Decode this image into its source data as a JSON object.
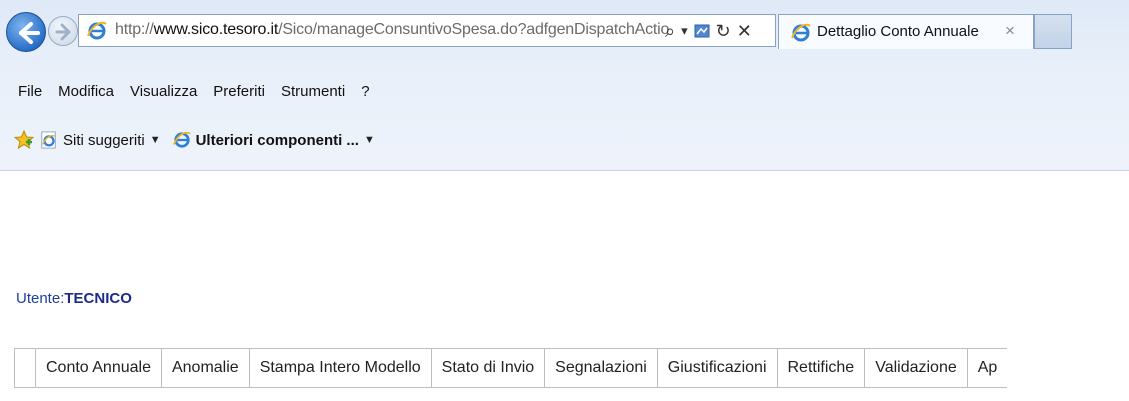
{
  "browser": {
    "url_prefix": "http://",
    "url_host": "www.sico.tesoro.it",
    "url_path": "/Sico/manageConsuntivoSpesa.do?adfgenDispatchActio",
    "tab_title": "Dettaglio Conto Annuale",
    "tab_close": "×",
    "address_tools": {
      "search": "⌕",
      "dropdown": "▾",
      "refresh": "↻",
      "stop": "✕"
    }
  },
  "menu": {
    "items": [
      "File",
      "Modifica",
      "Visualizza",
      "Preferiti",
      "Strumenti",
      "?"
    ]
  },
  "favorites": {
    "item1": "Siti suggeriti",
    "item2": "Ulteriori componenti ...",
    "caret": "▼"
  },
  "user": {
    "label": "Utente:",
    "name": "TECNICO"
  },
  "app_tabs": [
    "Conto Annuale",
    "Anomalie",
    "Stampa Intero Modello",
    "Stato di Invio",
    "Segnalazioni",
    "Giustificazioni",
    "Rettifiche",
    "Validazione",
    "Ap"
  ],
  "colors": {
    "accent": "#2a6fc9",
    "user_text": "#1c2b8a"
  }
}
